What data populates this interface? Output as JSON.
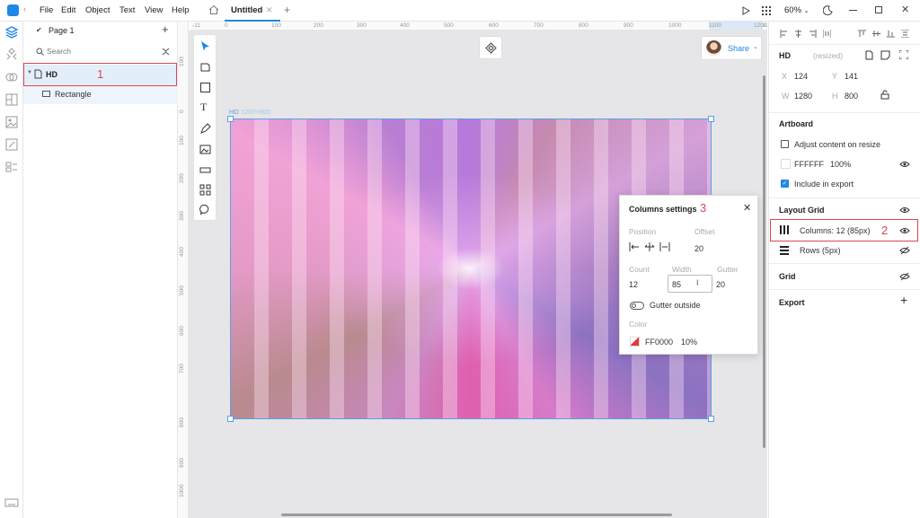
{
  "topbar": {
    "menu": [
      "File",
      "Edit",
      "Object",
      "Text",
      "View",
      "Help"
    ],
    "tab_title": "Untitled",
    "zoom": "60%"
  },
  "layers": {
    "page_name": "Page 1",
    "search_placeholder": "Search",
    "items": [
      {
        "label": "HD"
      },
      {
        "label": "Rectangle"
      }
    ]
  },
  "ruler": {
    "h_ticks": [
      "-11",
      "0",
      "100",
      "200",
      "300",
      "400",
      "500",
      "600",
      "700",
      "800",
      "900",
      "1000",
      "1100",
      "1200",
      "1280",
      "14"
    ],
    "v_ticks": [
      "100",
      "0",
      "100",
      "200",
      "300",
      "400",
      "500",
      "600",
      "700",
      "800",
      "900",
      "1000"
    ]
  },
  "canvas": {
    "artboard_label": "HD",
    "artboard_size": "1280×800",
    "share_label": "Share"
  },
  "props": {
    "name": "HD",
    "resized": "(resized)",
    "x_label": "X",
    "x": "124",
    "y_label": "Y",
    "y": "141",
    "w_label": "W",
    "w": "1280",
    "h_label": "H",
    "h": "800",
    "artboard_title": "Artboard",
    "adjust_content": "Adjust content on resize",
    "fill_hex": "FFFFFF",
    "fill_opacity": "100%",
    "include_export": "Include in export",
    "layout_grid_title": "Layout Grid",
    "columns_label": "Columns: 12 (85px)",
    "rows_label": "Rows (5px)",
    "grid_title": "Grid",
    "export_title": "Export"
  },
  "columns_popup": {
    "title": "Columns settings",
    "position_label": "Position",
    "offset_label": "Offset",
    "offset_value": "20",
    "count_label": "Count",
    "width_label": "Width",
    "gutter_label": "Gutter",
    "count_value": "12",
    "width_value": "85",
    "gutter_value": "20",
    "gutter_outside": "Gutter outside",
    "color_label": "Color",
    "color_hex": "FF0000",
    "color_opacity": "10%"
  },
  "annotations": [
    "1",
    "2",
    "3"
  ],
  "colors": {
    "accent": "#1e88e5",
    "annotation": "#e0454e",
    "selection": "#5aa0e6"
  }
}
